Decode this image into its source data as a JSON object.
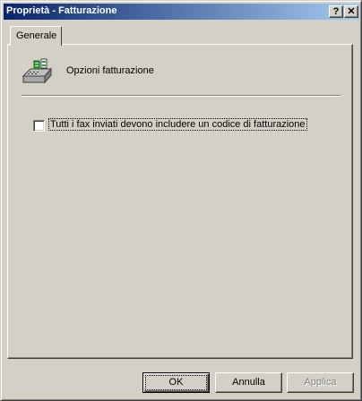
{
  "window": {
    "title": "Proprietà - Fatturazione",
    "help_label": "?",
    "close_label": "✕"
  },
  "tabs": [
    {
      "label": "Generale",
      "selected": true
    }
  ],
  "section": {
    "icon": "fax-billing-icon",
    "title": "Opzioni fatturazione"
  },
  "options": {
    "require_billing_code": {
      "label": "Tutti i fax inviati devono includere un codice di fatturazione",
      "checked": false
    }
  },
  "buttons": {
    "ok": "OK",
    "cancel": "Annulla",
    "apply": "Applica",
    "apply_enabled": false
  },
  "colors": {
    "titlebar_start": "#0a246a",
    "titlebar_end": "#a6caf0",
    "face": "#d4d0c8"
  }
}
